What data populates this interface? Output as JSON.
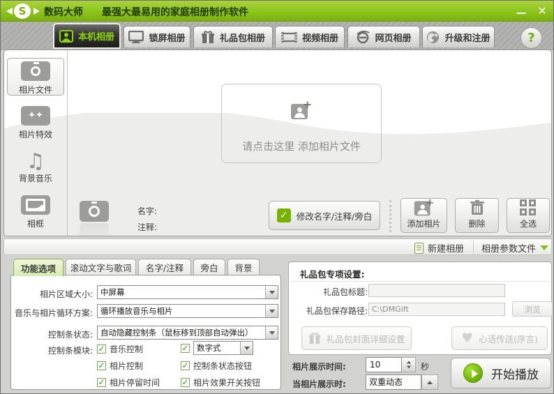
{
  "window": {
    "app_name": "数码大师",
    "subtitle": "最强大最易用的家庭相册制作软件",
    "minimize": "—",
    "close": "✕",
    "logo_letter": "S"
  },
  "help_label": "?",
  "nav_tabs": [
    {
      "label": "本机相册"
    },
    {
      "label": "锁屏相册"
    },
    {
      "label": "礼品包相册"
    },
    {
      "label": "视频相册"
    },
    {
      "label": "网页相册"
    },
    {
      "label": "升级和注册"
    }
  ],
  "sidebar": {
    "items": [
      {
        "label": "相片文件"
      },
      {
        "label": "相片特效"
      },
      {
        "label": "背景音乐"
      },
      {
        "label": "相框"
      }
    ]
  },
  "main": {
    "dropzone_text": "请点击这里 添加相片文件",
    "name_label": "名字:",
    "note_label": "注释:",
    "edit_button": "修改名字/注释/旁白",
    "add_photo_button": "添加相片",
    "delete_button": "删除",
    "select_all_button": "全选"
  },
  "album_bar": {
    "new_album": "新建相册",
    "album_params": "相册参数文件"
  },
  "settings": {
    "tabs": [
      {
        "label": "功能选项"
      },
      {
        "label": "滚动文字与歌词"
      },
      {
        "label": "名字/注释"
      },
      {
        "label": "旁白"
      },
      {
        "label": "背景"
      }
    ],
    "photo_area_label": "相片区域大小:",
    "photo_area_value": "中屏幕",
    "loop_label": "音乐与相片循环方案:",
    "loop_value": "循环播放音乐与相片",
    "bar_state_label": "控制条状态:",
    "bar_state_value": "自动隐藏控制条（鼠标移到顶部自动弹出）",
    "modules_label": "控制条模块:",
    "checkboxes": [
      {
        "label": "音乐控制",
        "checked": true
      },
      {
        "label": "相片控制",
        "checked": true
      },
      {
        "label": "相片停留时间",
        "checked": true
      },
      {
        "label": "控制条状态按钮",
        "checked": true
      },
      {
        "label": "相片效果开关按钮",
        "checked": true
      }
    ],
    "digital_dropdown_value": "数字式",
    "check_glyph": "✓"
  },
  "gift": {
    "header": "礼品包专项设置:",
    "title_label": "礼品包标题:",
    "title_value": "",
    "path_label": "礼品包保存路径:",
    "path_value": "C:\\DMGift",
    "browse_button": "浏览",
    "cover_button": "礼品包封面详细设置",
    "heart_button": "心语传送(序言)"
  },
  "playback": {
    "duration_label": "相片展示时间:",
    "duration_value": "10",
    "duration_unit": "秒",
    "display_label": "当相片展示时:",
    "display_value": "双重动态",
    "play_button": "开始播放"
  },
  "colors": {
    "titlebar_green": "#8cc41c",
    "active_tab_text": "#8ed600",
    "accent_green": "#74b400"
  }
}
